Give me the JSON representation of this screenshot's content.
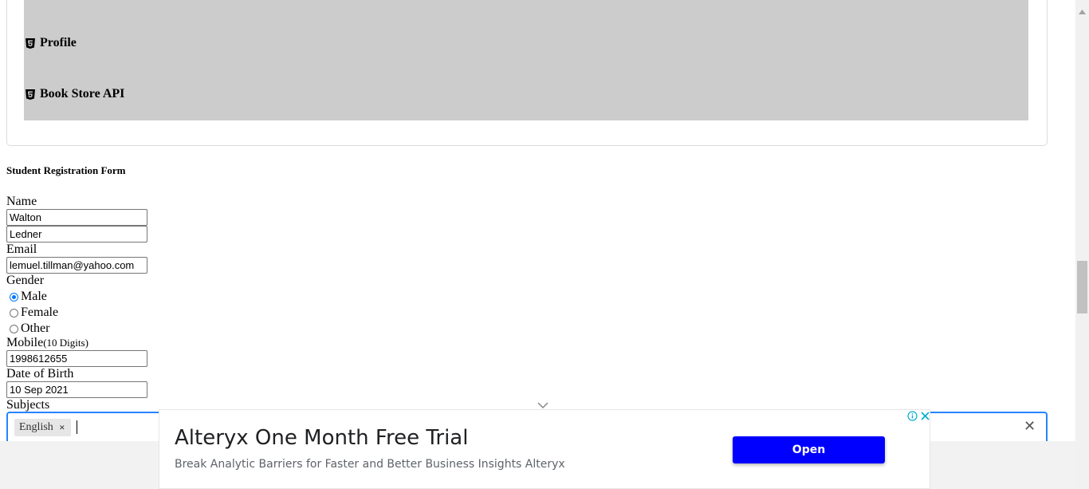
{
  "menu": {
    "items": [
      {
        "label": "Profile",
        "icon": "html5-icon"
      },
      {
        "label": "Book Store API",
        "icon": "html5-icon"
      }
    ]
  },
  "form": {
    "title": "Student Registration Form",
    "name_label": "Name",
    "first_name_value": "Walton",
    "last_name_value": "Ledner",
    "email_label": "Email",
    "email_value": "lemuel.tillman@yahoo.com",
    "gender_label": "Gender",
    "gender_options": [
      "Male",
      "Female",
      "Other"
    ],
    "gender_selected": "Male",
    "mobile_label": "Mobile",
    "mobile_hint": "(10 Digits)",
    "mobile_value": "1998612655",
    "dob_label": "Date of Birth",
    "dob_value": "10 Sep 2021",
    "subjects_label": "Subjects",
    "subjects_selected": [
      "English"
    ]
  },
  "ad": {
    "title": "Alteryx One Month Free Trial",
    "description": "Break Analytic Barriers for Faster and Better Business Insights Alteryx",
    "button_label": "Open",
    "button_color": "#0000ff"
  },
  "colors": {
    "panel_gray": "#cccccc",
    "focus_blue": "#2684ff",
    "radio_blue": "#0075ff"
  }
}
